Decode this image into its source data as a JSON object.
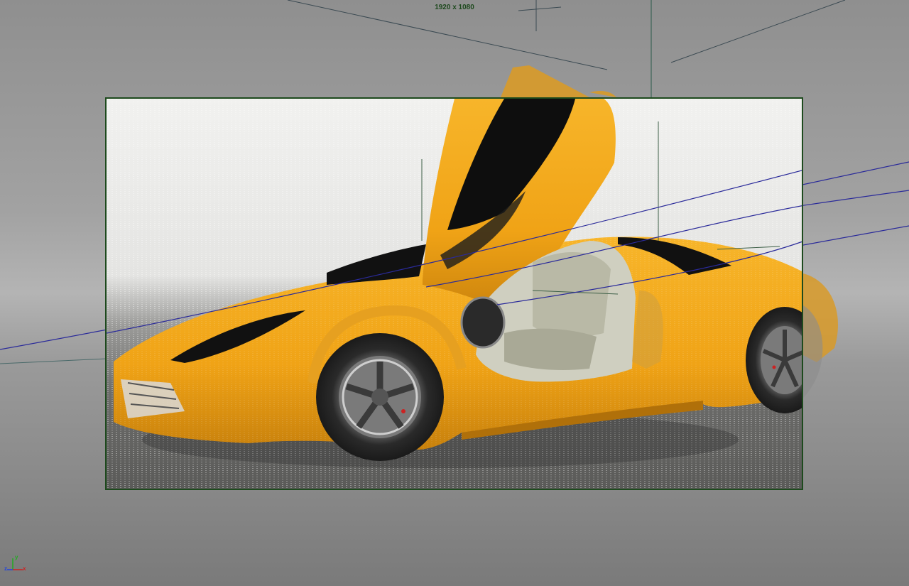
{
  "viewport": {
    "resolution_label": "1920 x 1080",
    "axes": {
      "x": "x",
      "y": "y",
      "z": "z"
    },
    "colors": {
      "gate_border": "#1d4a1d",
      "car_body": "#f2a818",
      "curve_blue": "#2a2a9a",
      "axis_x": "#cc2222",
      "axis_y": "#22aa22",
      "axis_z": "#2244dd"
    }
  }
}
